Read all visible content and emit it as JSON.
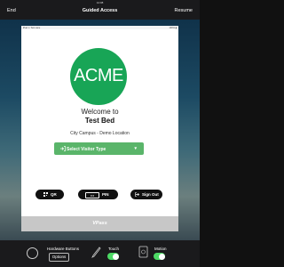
{
  "top_bar": {
    "end": "End",
    "title": "Guided Access",
    "resume": "Resume",
    "clock": "14:08"
  },
  "status_bar": {
    "left": "iPad ✦ Test Lane",
    "right": "100% ▮"
  },
  "card": {
    "logo_text": "ACME",
    "welcome": "Welcome to",
    "site_name": "Test Bed",
    "location": "City Campus - Demo Location",
    "visitor_button": "Select Visitor Type",
    "buttons": {
      "qr": "QR",
      "pin": "PIN",
      "signout": "Sign Out"
    },
    "brand": "VPass"
  },
  "bottom_bar": {
    "hardware_buttons": "Hardware Buttons",
    "options": "Options",
    "touch": "Touch",
    "motion": "Motion",
    "touch_on": true,
    "motion_on": true
  },
  "colors": {
    "brand_green": "#18a556",
    "button_green": "#5ab56a",
    "toggle_green": "#4cd964"
  }
}
